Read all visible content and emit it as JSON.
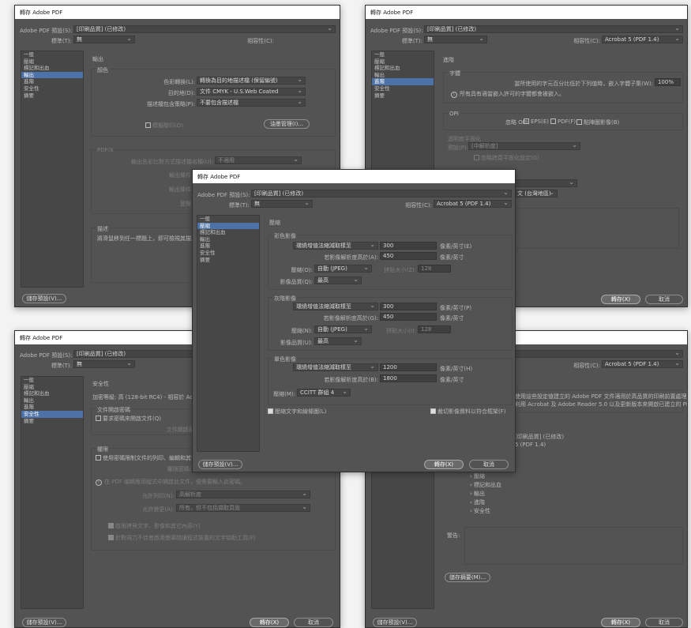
{
  "common": {
    "preset_label": "Adobe PDF 預設(S):",
    "preset_value": "[印刷品質] (已修改)",
    "standard_label": "標準(T):",
    "standard_value": "無",
    "compat_label": "相容性(C):",
    "compat_value": "Acrobat 5 (PDF 1.4)",
    "save_preset": "儲存預設(V)...",
    "save": "轉存(X)",
    "cancel": "取消",
    "sidebar": [
      "一般",
      "壓縮",
      "標記和出血",
      "輸出",
      "進階",
      "安全性",
      "摘要"
    ]
  },
  "windows": {
    "output": {
      "title": "轉存 Adobe PDF"
    },
    "advanced": {
      "title": "轉存 Adobe PDF"
    },
    "security": {
      "title": "轉存 Adobe PDF"
    },
    "summary": {
      "title": "轉存 Adobe PDF"
    },
    "compression": {
      "title": "轉存 Adobe PDF"
    }
  },
  "output_panel": {
    "section": "輸出",
    "color_group": "顏色",
    "conv_label": "色彩轉換(L):",
    "conv_value": "轉換為目的地描述檔 (保留編號)",
    "dest_label": "目的地(D):",
    "dest_value": "文件 CMYK - U.S.Web Coated",
    "profile_label": "描述檔包含策略(P):",
    "profile_value": "不要包含描述檔",
    "sim_overprint": "模擬壓印(O)",
    "ink_manager": "油墨管理(I)...",
    "pdfx_group": "PDF/X",
    "output_intent_label": "輸出色彩比對方式描述檔名稱(U):",
    "output_intent_value": "不適用",
    "output_cond_label": "輸出條件",
    "output_id_label": "輸出條件",
    "registry_label": "登錄",
    "desc_group": "描述",
    "desc_text": "將滑鼠移到任一標題上，即可檢視其描述。"
  },
  "advanced_panel": {
    "section": "進階",
    "fonts_group": "字體",
    "subset_label": "當所使用的字元百分比低於下列值時，嵌入字體子集(W):",
    "subset_value": "100%",
    "font_note": "所有具有適當嵌入許可的字體都會被嵌入。",
    "opi_group": "OPI",
    "opi_omit": "忽略 OPI:",
    "opi_eps": "EPS(E)",
    "opi_pdf": "PDF(F)",
    "opi_bitmap": "點陣圖影像(B)",
    "flatten_group": "透明度平面化",
    "flatten_preset_label": "預設(P):",
    "flatten_preset_value": "[中解析度]",
    "ignore_override": "忽略跨頁平面化設定(G)",
    "lang_value": "文 (台灣地區)"
  },
  "security_panel": {
    "section": "安全性",
    "encryption": "加密等級: 高 (128-bit RC4) - 相容於 Acrobat 5 及更新版本",
    "doc_open_group": "文件開啟密碼",
    "require_open": "要求密碼來開啟文件(Q)",
    "open_pw_label": "文件開啟密碼(D):",
    "perm_group": "權限",
    "restrict": "使用密碼限制文件的列印、編輯和其它作業(R)",
    "perm_pw_label": "權限密碼(E):",
    "perm_note": "在 PDF 編輯應用程式中開啟此文件，便需要輸入此密碼。",
    "print_label": "允許列印(N):",
    "print_value": "高解析度",
    "change_label": "允許變更(A):",
    "change_value": "所有，但不包括擷取頁面",
    "copy_text": "啟用拷貝文字、影像和其它內容(Y)",
    "screen_reader": "針對視力不佳者啟用螢幕閱讀程式裝置的文字協助工具(P)"
  },
  "summary_panel": {
    "desc_text_1": "使用這些設定值建立的 Adobe PDF 文件適用於高品質的印刷前置處理。",
    "desc_text_2": "利用 Acrobat 及 Adobe Reader 5.0 以及更新版本來開啟已建立的 PDF 文件。",
    "preset_echo": "[印刷品質] (已修改)",
    "compat_echo": "5 (PDF 1.4)",
    "tree": [
      "一般",
      "壓縮",
      "標記和出血",
      "輸出",
      "進階",
      "安全性"
    ],
    "warning_label": "警告:",
    "save_summary": "儲存摘要(M)..."
  },
  "compression_panel": {
    "section": "壓縮",
    "color_group": "彩色影像",
    "gray_group": "灰階影像",
    "mono_group": "單色影像",
    "bicubic": "環繞增值法縮減取樣至",
    "color_ppi": "300",
    "color_above": "若影像解析度高於(A):",
    "color_above_val": "450",
    "color_comp_label": "壓縮(O):",
    "color_comp_value": "自動 (JPEG)",
    "tile_label": "拼貼大小(Z):",
    "tile_value": "128",
    "color_quality_label": "影像品質(Q):",
    "color_quality_value": "最高",
    "unit_ppi_e": "像素/英寸(E)",
    "unit_ppi": "像素/英寸",
    "gray_ppi": "300",
    "unit_ppi_p": "像素/英寸(P)",
    "gray_above": "若影像解析度高於(G):",
    "gray_above_val": "450",
    "gray_comp_label": "壓縮(N):",
    "gray_comp_value": "自動 (JPEG)",
    "gray_tile_label": "拼貼大小(I):",
    "gray_tile_value": "128",
    "gray_quality_label": "影像品質(U):",
    "gray_quality_value": "最高",
    "mono_ppi": "1200",
    "unit_ppi_h": "像素/英寸(H)",
    "mono_above": "若影像解析度高於(B):",
    "mono_above_val": "1800",
    "mono_comp_label": "壓縮(M):",
    "mono_comp_value": "CCITT 群組 4",
    "compress_text": "壓縮文字和線條圖(L)",
    "crop_image": "裁切影像資料以符合框架(F)"
  }
}
